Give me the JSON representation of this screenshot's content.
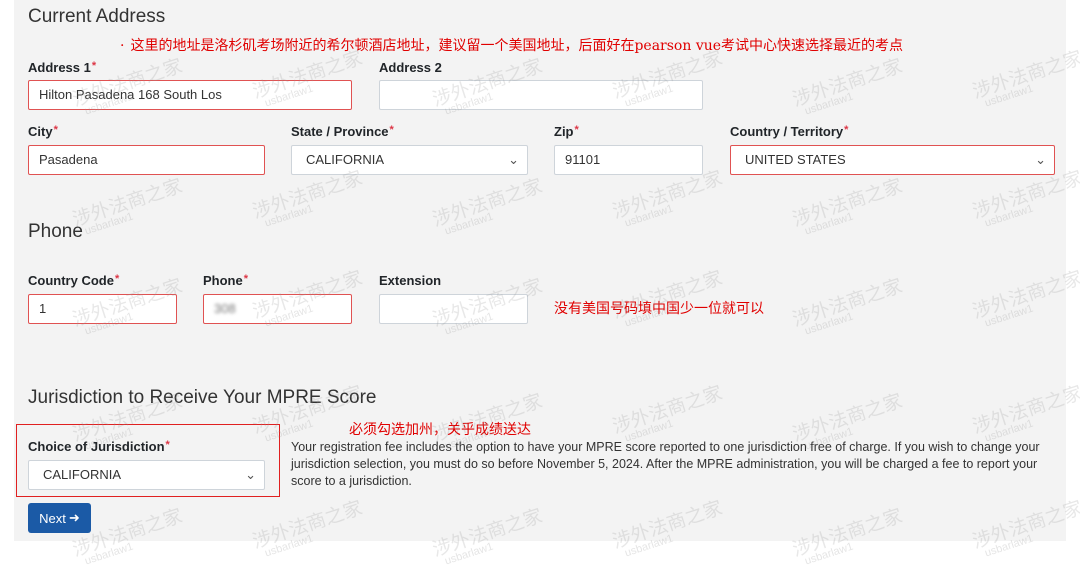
{
  "address": {
    "title": "Current Address",
    "address1_label": "Address 1",
    "address1_value": "Hilton Pasadena 168 South Los",
    "address2_label": "Address 2",
    "address2_value": "",
    "city_label": "City",
    "city_value": "Pasadena",
    "state_label": "State / Province",
    "state_value": "CALIFORNIA",
    "zip_label": "Zip",
    "zip_value": "91101",
    "country_label": "Country / Territory",
    "country_value": "UNITED STATES",
    "required_mark": "*"
  },
  "phone": {
    "title": "Phone",
    "country_code_label": "Country Code",
    "country_code_value": "1",
    "phone_label": "Phone",
    "phone_value": "308",
    "extension_label": "Extension",
    "extension_value": ""
  },
  "jurisdiction": {
    "title": "Jurisdiction to Receive Your MPRE Score",
    "choice_label": "Choice of Jurisdiction",
    "choice_value": "CALIFORNIA",
    "description": "Your registration fee includes the option to have your MPRE score reported to one jurisdiction free of charge. If you wish to change your jurisdiction selection, you must do so before November 5, 2024. After the MPRE administration, you will be charged a fee to report your score to a jurisdiction."
  },
  "next_button": {
    "label": "Next",
    "icon": "arrow-right-icon"
  },
  "annotations": {
    "address_note": "这里的地址是洛杉矶考场附近的希尔顿酒店地址，建议留一个美国地址，后面好在pearson vue考试中心快速选择最近的考点",
    "phone_note": "没有美国号码填中国少一位就可以",
    "jurisdiction_note": "必须勾选加州，关乎成绩送达",
    "note_bullet": "·"
  },
  "watermark": {
    "text": "涉外法商之家",
    "sub": "usbarlaw1"
  },
  "colors": {
    "panel_bg": "#f3f3f3",
    "error_border": "#e05252",
    "annotation_red": "#e00000",
    "button_blue": "#1b5aa6",
    "required_red": "#dc3545"
  }
}
